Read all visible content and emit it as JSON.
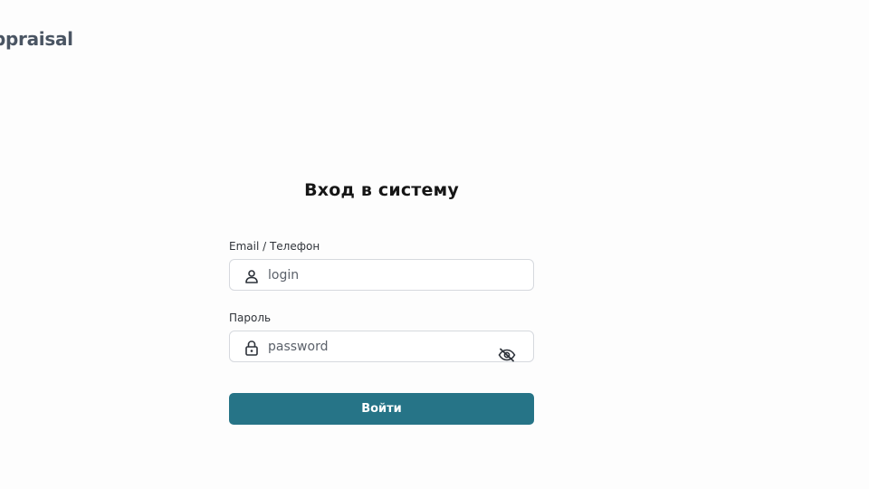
{
  "brand": {
    "name": "ppraisal"
  },
  "login_form": {
    "title": "Вход в систему",
    "login_field": {
      "label": "Email / Телефон",
      "placeholder": "login",
      "value": "",
      "icon": "user-icon"
    },
    "password_field": {
      "label": "Пароль",
      "placeholder": "password",
      "value": "",
      "icon": "lock-icon",
      "toggle_icon": "eye-off-icon"
    },
    "submit_label": "Войти"
  },
  "colors": {
    "accent": "#267487",
    "background": "#fdfdfd",
    "brand_text": "#4a5563",
    "input_border": "#d6d9de"
  }
}
